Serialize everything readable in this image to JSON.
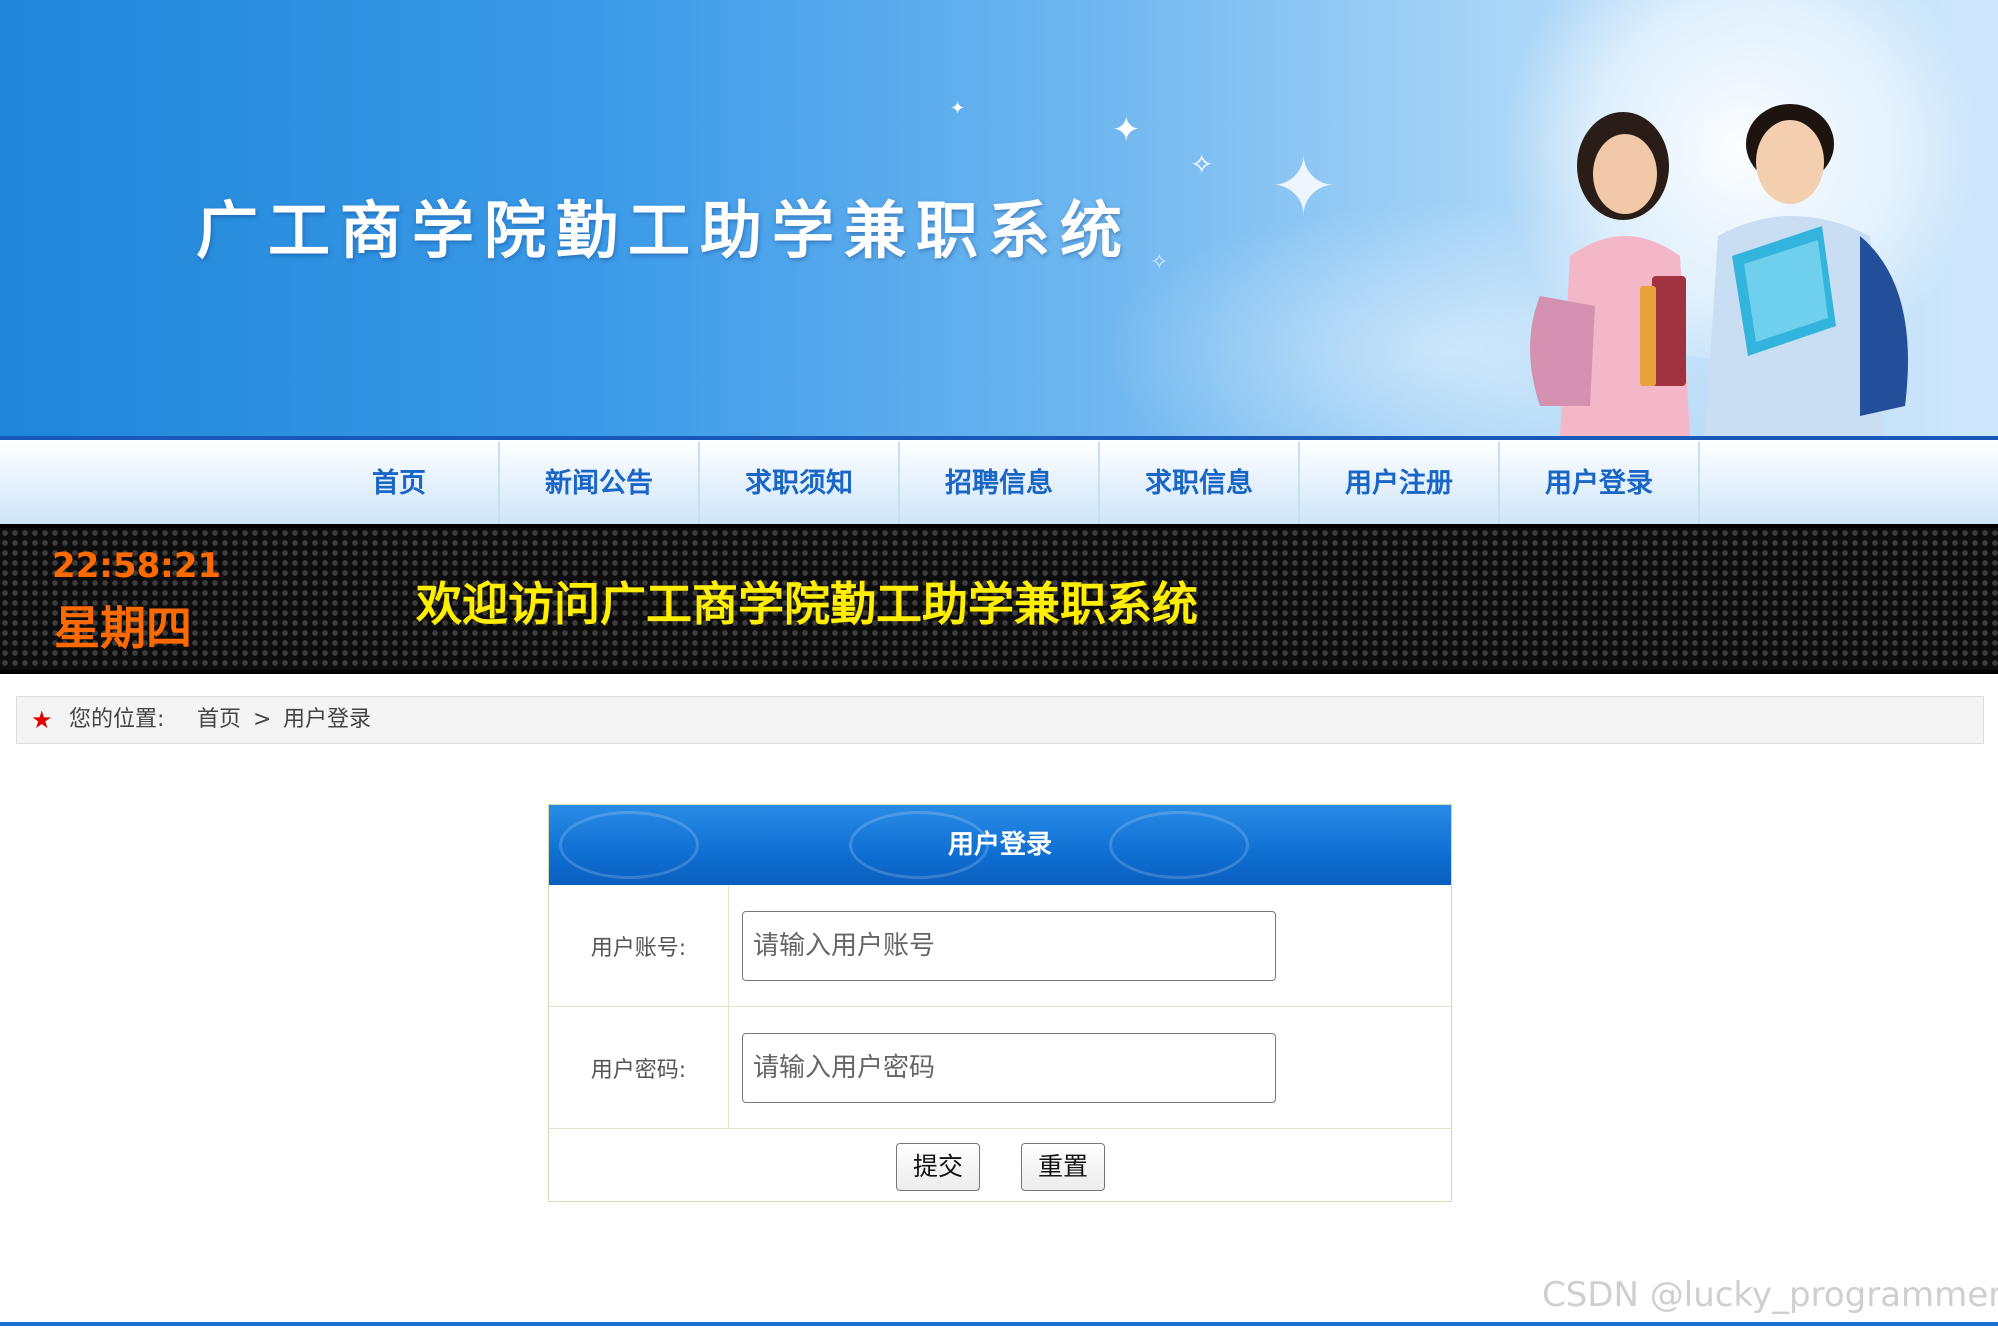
{
  "header": {
    "title": "广工商学院勤工助学兼职系统"
  },
  "nav": {
    "items": [
      {
        "label": "首页"
      },
      {
        "label": "新闻公告"
      },
      {
        "label": "求职须知"
      },
      {
        "label": "招聘信息"
      },
      {
        "label": "求职信息"
      },
      {
        "label": "用户注册"
      },
      {
        "label": "用户登录"
      }
    ]
  },
  "marquee": {
    "time": "22:58:21",
    "weekday": "星期四",
    "welcome": "欢迎访问广工商学院勤工助学兼职系统"
  },
  "breadcrumb": {
    "label": "您的位置:",
    "home": "首页",
    "separator": ">",
    "current": "用户登录"
  },
  "login": {
    "title": "用户登录",
    "account_label": "用户账号:",
    "account_placeholder": "请输入用户账号",
    "account_value": "",
    "password_label": "用户密码:",
    "password_placeholder": "请输入用户密码",
    "password_value": "",
    "submit_label": "提交",
    "reset_label": "重置"
  },
  "watermark": "CSDN @lucky_programmer",
  "colors": {
    "nav_text": "#1a66c6",
    "clock": "#ff6a00",
    "welcome": "#ffee00",
    "panel_header": "#0f6fd3"
  }
}
